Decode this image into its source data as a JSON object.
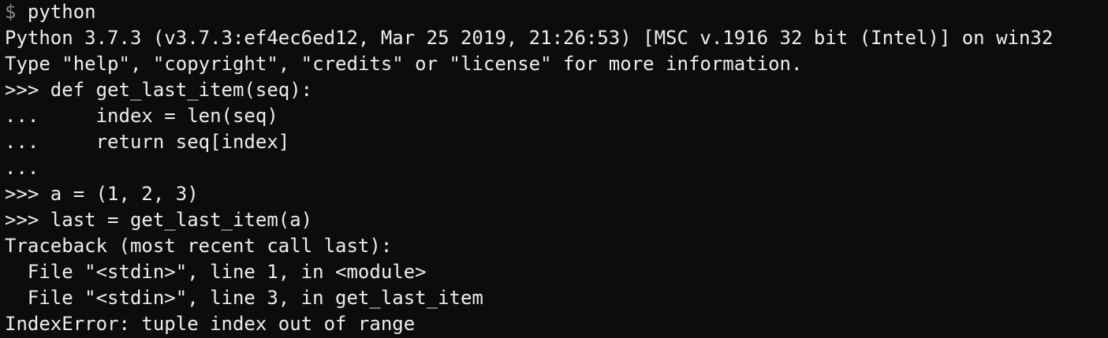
{
  "terminal": {
    "background_color": "#0c0c0c",
    "text_color": "#ededed",
    "prompt_color": "#8a8a8a",
    "shell_prompt": "$",
    "shell_command": " python",
    "lines": [
      "Python 3.7.3 (v3.7.3:ef4ec6ed12, Mar 25 2019, 21:26:53) [MSC v.1916 32 bit (Intel)] on win32",
      "Type \"help\", \"copyright\", \"credits\" or \"license\" for more information.",
      ">>> def get_last_item(seq):",
      "...     index = len(seq)",
      "...     return seq[index]",
      "...",
      ">>> a = (1, 2, 3)",
      ">>> last = get_last_item(a)",
      "Traceback (most recent call last):",
      "  File \"<stdin>\", line 1, in <module>",
      "  File \"<stdin>\", line 3, in get_last_item",
      "IndexError: tuple index out of range"
    ]
  }
}
